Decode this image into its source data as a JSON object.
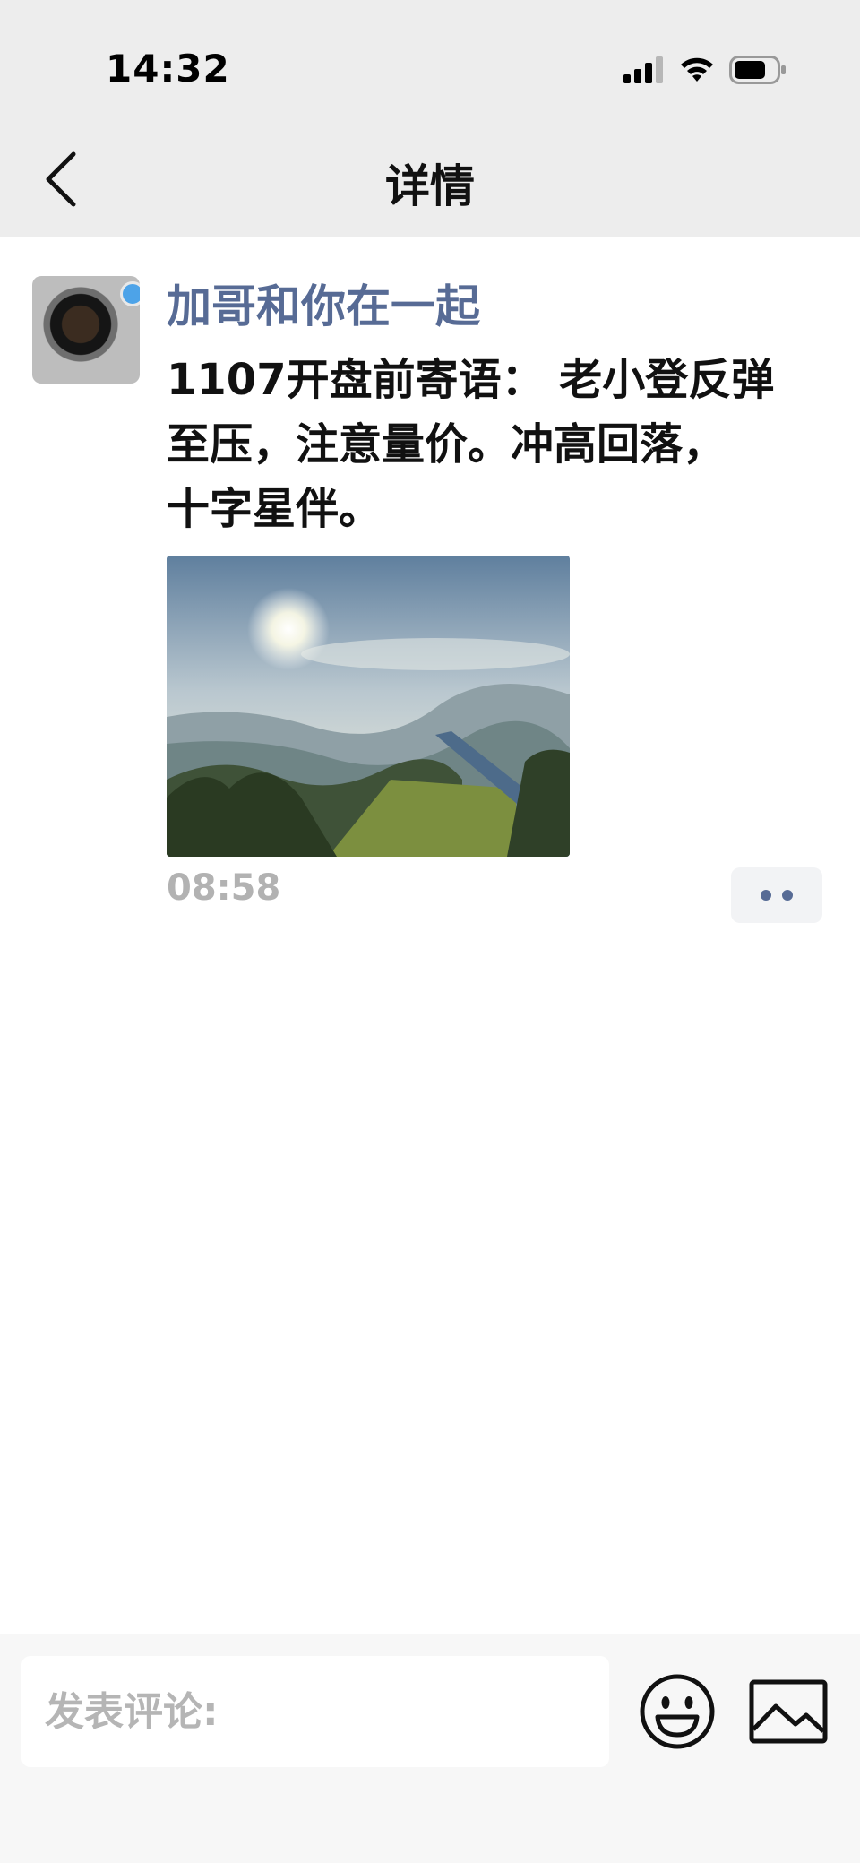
{
  "status_bar": {
    "time": "14:32",
    "icons": [
      "cellular-signal-icon",
      "wifi-icon",
      "battery-icon"
    ]
  },
  "nav": {
    "back_icon": "chevron-left-icon",
    "title": "详情"
  },
  "post": {
    "author": "加哥和你在一起",
    "text": "1107开盘前寄语： 老小登反弹\n至压，注意量价。冲高回落，\n十字星伴。",
    "time": "08:58",
    "more_icon": "more-dots-icon",
    "image_subject": "landscape-photo"
  },
  "comment_bar": {
    "placeholder": "发表评论:",
    "emoji_icon": "emoji-smile-icon",
    "image_icon": "image-icon"
  },
  "colors": {
    "header_bg": "#ededed",
    "author_link": "#576b95",
    "time_gray": "#b2b2b2",
    "comment_bar_bg": "#f7f7f7"
  }
}
